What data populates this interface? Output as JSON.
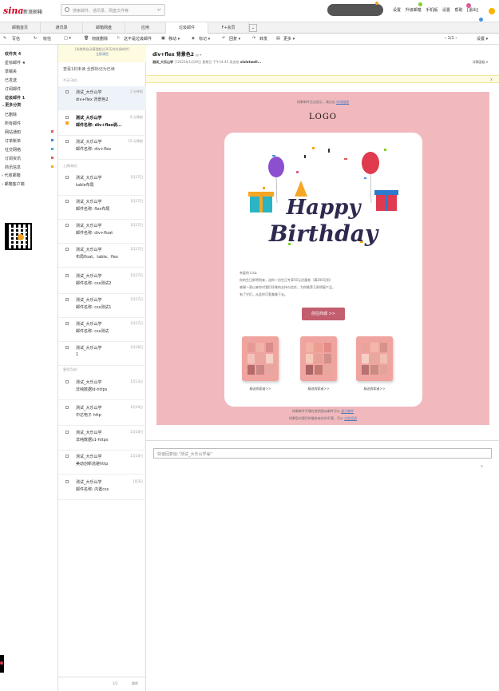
{
  "app": {
    "logo": "sina",
    "logo_sub": "新浪邮箱"
  },
  "search": {
    "placeholder": "搜索邮件、通讯录、网盘文件等"
  },
  "top_links": [
    "设置",
    "升级邮箱",
    "手机版",
    "设置",
    "帮助",
    "[退出]"
  ],
  "nav_tabs": [
    "邮箱首页",
    "通讯录",
    "邮箱网盘",
    "应用",
    "垃圾邮件",
    "F+会员"
  ],
  "toolbar": {
    "write": "写信",
    "receive": "收信",
    "select": "□ ▾",
    "delete": "彻底删除",
    "not_spam": "这不是垃圾邮件",
    "move": "移动 ▾",
    "mark": "标记 ▾",
    "reply": "回复 ▾",
    "forward": "转发",
    "more": "更多 ▾",
    "pager": "‹  1/1  ›",
    "settings": "设置 ▾"
  },
  "sidebar": {
    "items": [
      {
        "label": "收件夹 4",
        "strong": true
      },
      {
        "label": "星标邮件 ★",
        "strong": false
      },
      {
        "label": "草稿夹",
        "strong": false
      },
      {
        "label": "已发送",
        "strong": false
      },
      {
        "label": "订阅邮件",
        "strong": false
      },
      {
        "label": "垃圾邮件 1",
        "strong": true
      }
    ],
    "more_header": "⌄更多分类",
    "categories": [
      {
        "label": "已删除",
        "color": ""
      },
      {
        "label": "所有邮件",
        "color": ""
      },
      {
        "label": "网站通知",
        "color": "#e05a5a"
      },
      {
        "label": "订单账单",
        "color": "#3a8ad3"
      },
      {
        "label": "社交网络",
        "color": "#3ab0c4"
      },
      {
        "label": "订阅资讯",
        "color": "#e05a5a"
      },
      {
        "label": "商讯信息",
        "color": "#f5a623"
      }
    ],
    "proxy": "› 代收邮箱",
    "ad": "› 邮箱客户端"
  },
  "list": {
    "notice_line1": "[系统将自动清理超过30天的垃圾邮件]",
    "notice_line2": "立即清空",
    "links": "查看1封未读    全部标记为已读",
    "groups": [
      "今天(3封)",
      "上周(8封)",
      "更早(5封)"
    ],
    "mails": [
      {
        "from": "测试_大乐山学",
        "subject": "div+flex 背景色2",
        "time": "2 分钟前",
        "bold": false,
        "sel": true
      },
      {
        "from": "测试_大乐山学",
        "subject": "邮件名称: div+flex调...",
        "time": "6 分钟前",
        "bold": true,
        "sel": false
      },
      {
        "from": "测试_大乐山学",
        "subject": "邮件名称: div+flex",
        "time": "15 分钟前",
        "bold": false,
        "sel": false
      },
      {
        "from": "测试_大乐山学",
        "subject": "table布局",
        "time": "1月17日",
        "bold": false,
        "sel": false
      },
      {
        "from": "测试_大乐山学",
        "subject": "邮件名称: flex布局",
        "time": "1月17日",
        "bold": false,
        "sel": false
      },
      {
        "from": "测试_大乐山学",
        "subject": "邮件名称: div+float",
        "time": "1月17日",
        "bold": false,
        "sel": false
      },
      {
        "from": "测试_大乐山学",
        "subject": "布局float、table、flex",
        "time": "1月17日",
        "bold": false,
        "sel": false
      },
      {
        "from": "测试_大乐山学",
        "subject": "邮件名称: css测试2",
        "time": "1月17日",
        "bold": false,
        "sel": false
      },
      {
        "from": "测试_大乐山学",
        "subject": "邮件名称: css测试1",
        "time": "1月17日",
        "bold": false,
        "sel": false
      },
      {
        "from": "测试_大乐山学",
        "subject": "邮件名称: css测试",
        "time": "1月17日",
        "bold": false,
        "sel": false
      },
      {
        "from": "测试_大乐山学",
        "subject": "1",
        "time": "1月16日",
        "bold": false,
        "sel": false
      },
      {
        "from": "测试_大乐山学",
        "subject": "非纯数据ld-https",
        "time": "1月13日",
        "bold": false,
        "sel": false
      },
      {
        "from": "测试_大乐山学",
        "subject": "中达电子 http",
        "time": "1月10日",
        "bold": false,
        "sel": false
      },
      {
        "from": "测试_大乐山学",
        "subject": "非纯数据s1-https",
        "time": "1月10日",
        "bold": false,
        "sel": false
      },
      {
        "from": "测试_大乐山学",
        "subject": "美动创新逃避http",
        "time": "1月10日",
        "bold": false,
        "sel": false
      },
      {
        "from": "测试_大乐山学",
        "subject": "邮件名称: 内置css",
        "time": "1月3日",
        "bold": false,
        "sel": false
      }
    ],
    "pager_text": "1/1",
    "pager_next": "跳转"
  },
  "reader": {
    "subject": "div+flex 背景色2",
    "subject_icons": "▤ ▾",
    "meta_prefix": "测试_大乐山学",
    "meta_mid": " 于2023年1月29日 星期日 下午14:45 发送给 ",
    "meta_to": "violetwell...",
    "detail": "详情面板 ▾",
    "close": "x",
    "email": {
      "header_text": "如果邮件无法显示，请点击",
      "header_link": "浏览链接",
      "logo": "LOGO",
      "greeting": [
        "亲爱的 Lisa:",
        "你的生日即将到来，送你一份生日专享50元优惠券（满200可用）",
        "感谢一直以来你对我们珍珠的支持与信任，为你推荐几款明星产品，",
        "有了它们，从此你可惹美美下去。"
      ],
      "button": "前往商城 >>",
      "products": [
        {
          "label": "精选探索者>>",
          "colors": [
            "#e79a95",
            "#f1b3a8",
            "#d98c8a",
            "#f2c3bb",
            "#e9a79f",
            "#f6d1c6",
            "#b66b6b",
            "#c98682",
            "#e6a7a0"
          ]
        },
        {
          "label": "精选探索者>>",
          "colors": [
            "#f3b3a5",
            "#ec9d90",
            "#e48b86",
            "#f6c9bb",
            "#e7a298",
            "#d08f8a",
            "#a96363",
            "#c37a74",
            "#e6a79c"
          ]
        },
        {
          "label": "精选探索者>>",
          "colors": [
            "#eaa39a",
            "#f3b7aa",
            "#d7928b",
            "#f6cfc4",
            "#e8a89e",
            "#f1c0b3",
            "#b97272",
            "#c98b84",
            "#e3a29a"
          ]
        }
      ],
      "footer_line1": "如果邮件不想在收到类似邮件可以",
      "footer_link1": "退订邮件",
      "footer_line2": "如果您对我们的服务有任何不满，可以",
      "footer_link2": "点此投诉"
    },
    "reply_placeholder": "快速回复给:\"测试_大乐山学😀\"",
    "reply_close": "x"
  }
}
